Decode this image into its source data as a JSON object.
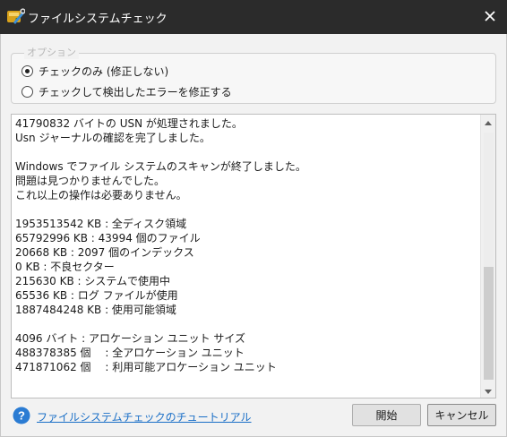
{
  "window": {
    "title": "ファイルシステムチェック"
  },
  "icons": {
    "app": "disk-wrench-icon",
    "close": "close-icon",
    "help": "help-circle-icon",
    "scroll_up": "chevron-up-icon",
    "scroll_down": "chevron-down-icon"
  },
  "colors": {
    "titlebar": "#2b2b2b",
    "link": "#1a6fc7",
    "help_icon": "#2b7cd3",
    "body": "#f2f2f2"
  },
  "options": {
    "legend": "オプション",
    "items": [
      {
        "label": "チェックのみ (修正しない)",
        "selected": true
      },
      {
        "label": "チェックして検出したエラーを修正する",
        "selected": false
      }
    ]
  },
  "log": {
    "lines": [
      "41790832 バイトの USN が処理されました。",
      "Usn ジャーナルの確認を完了しました。",
      "",
      "Windows でファイル システムのスキャンが終了しました。",
      "問題は見つかりませんでした。",
      "これ以上の操作は必要ありません。",
      "",
      "1953513542 KB : 全ディスク領域",
      "65792996 KB : 43994 個のファイル",
      "20668 KB : 2097 個のインデックス",
      "0 KB : 不良セクター",
      "215630 KB : システムで使用中",
      "65536 KB : ログ ファイルが使用",
      "1887484248 KB : 使用可能領域",
      "",
      "4096 バイト : アロケーション ユニット サイズ",
      "488378385 個　 : 全アロケーション ユニット",
      "471871062 個　 : 利用可能アロケーション ユニット"
    ]
  },
  "footer": {
    "tutorial_link": "ファイルシステムチェックのチュートリアル",
    "start_button": "開始",
    "cancel_button": "キャンセル"
  }
}
